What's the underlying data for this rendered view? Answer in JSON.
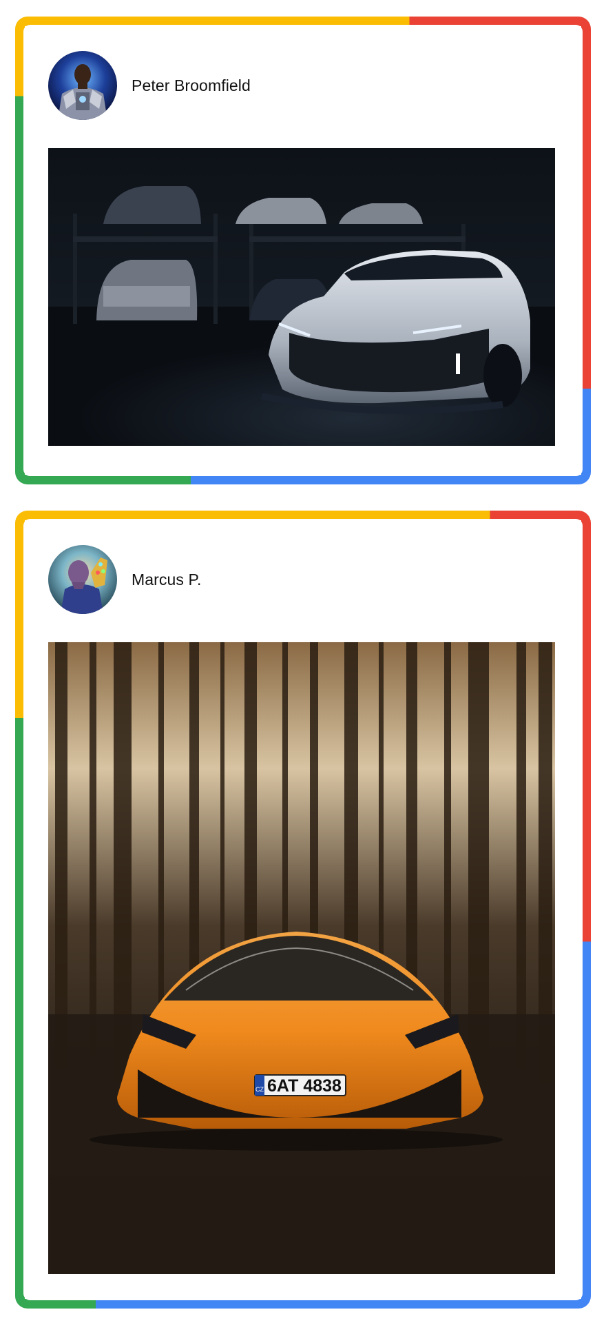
{
  "posts": [
    {
      "author": "Peter Broomfield",
      "avatar_icon": "armored-hero-avatar",
      "photo_subject": "garage-sports-car-photo"
    },
    {
      "author": "Marcus P.",
      "avatar_icon": "titan-with-gauntlet-avatar",
      "photo_subject": "forest-supercar-photo",
      "license_plate": "6AT 4838",
      "plate_country": "CZ"
    }
  ],
  "colors": {
    "yellow": "#fbbc04",
    "red": "#ea4335",
    "green": "#34a853",
    "blue": "#4285f4"
  }
}
